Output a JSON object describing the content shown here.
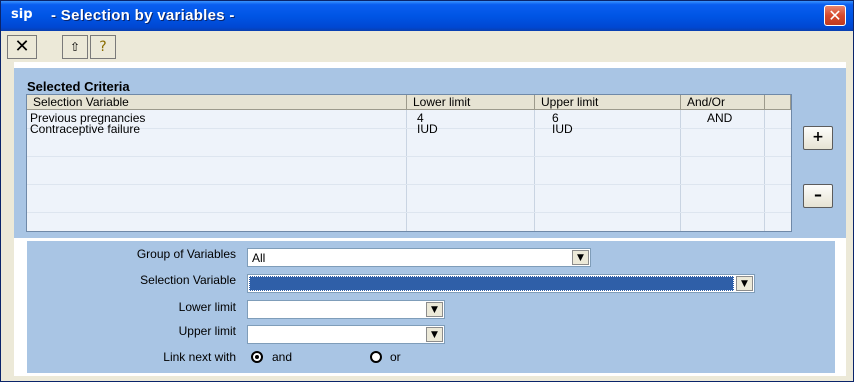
{
  "window": {
    "title": " - Selection by variables -",
    "app_icon": "sip",
    "close_icon": "close-icon"
  },
  "toolbar": {
    "exit_glyph": "✕",
    "up_glyph": "⇧",
    "help_glyph": "?"
  },
  "criteria": {
    "section_title": "Selected Criteria",
    "columns": [
      "Selection Variable",
      "Lower limit",
      "Upper limit",
      "And/Or"
    ],
    "rows": [
      {
        "variable": "Previous pregnancies",
        "lower": "4",
        "upper": "6",
        "andor": "AND"
      },
      {
        "variable": "Contraceptive failure",
        "lower": "IUD",
        "upper": "IUD",
        "andor": ""
      }
    ],
    "add_label": "+",
    "remove_label": "–"
  },
  "form": {
    "group_label": "Group of Variables",
    "group_value": "All",
    "selection_label": "Selection Variable",
    "selection_value": "",
    "lower_label": "Lower limit",
    "lower_value": "",
    "upper_label": "Upper limit",
    "upper_value": "",
    "link_label": "Link next with",
    "link_options": [
      "and",
      "or"
    ],
    "link_selected": "and"
  },
  "colors": {
    "titlebar": "#0055e5",
    "panel": "#a9c5e4",
    "selection_highlight": "#2f5fa8",
    "close_button": "#d74a2d"
  }
}
